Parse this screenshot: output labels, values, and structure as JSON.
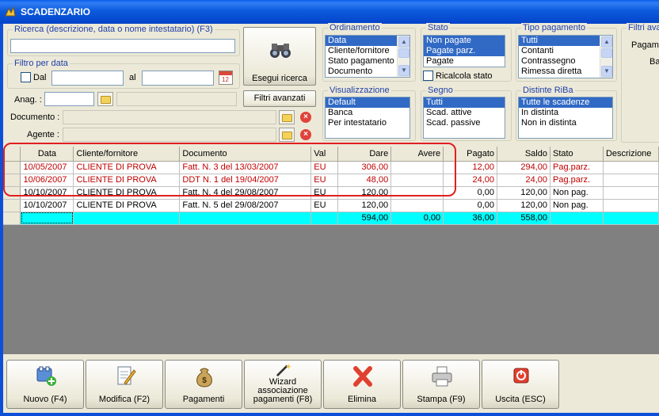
{
  "window": {
    "title": "SCADENZARIO"
  },
  "search": {
    "group_title": "Ricerca (descrizione, data o nome intestatario) (F3)",
    "value": "",
    "button_label": "Esegui ricerca"
  },
  "date_filter": {
    "group_title": "Filtro per data",
    "from_label": "Dal",
    "to_label": "al",
    "from_value": "",
    "to_value": ""
  },
  "fields": {
    "anag_label": "Anag. :",
    "documento_label": "Documento :",
    "agente_label": "Agente :",
    "advanced_button": "Filtri avanzati"
  },
  "ordinamento": {
    "title": "Ordinamento",
    "items": [
      "Data",
      "Cliente/fornitore",
      "Stato pagamento",
      "Documento"
    ],
    "selected": [
      0
    ]
  },
  "stato": {
    "title": "Stato",
    "items": [
      "Non pagate",
      "Pagate parz.",
      "Pagate"
    ],
    "selected": [
      0,
      1
    ],
    "recalc_label": "Ricalcola stato"
  },
  "tipo_pagamento": {
    "title": "Tipo pagamento",
    "items": [
      "Tutti",
      "Contanti",
      "Contrassegno",
      "Rimessa diretta"
    ],
    "selected": [
      0
    ]
  },
  "filtri_avanzati": {
    "title": "Filtri avanz",
    "line1": "Pagame",
    "line2": "Ba"
  },
  "visualizzazione": {
    "title": "Visualizzazione",
    "items": [
      "Default",
      "Banca",
      "Per intestatario"
    ],
    "selected": [
      0
    ]
  },
  "segno": {
    "title": "Segno",
    "items": [
      "Tutti",
      "Scad. attive",
      "Scad. passive"
    ],
    "selected": [
      0
    ]
  },
  "distinte": {
    "title": "Distinte RiBa",
    "items": [
      "Tutte le scadenze",
      "In distinta",
      "Non in distinta"
    ],
    "selected": [
      0
    ]
  },
  "grid": {
    "columns": [
      "Data",
      "Cliente/fornitore",
      "Documento",
      "Val",
      "Dare",
      "Avere",
      "Pagato",
      "Saldo",
      "Stato",
      "Descrizione"
    ],
    "rows": [
      {
        "data": "10/05/2007",
        "cliente": "CLIENTE DI PROVA",
        "documento": "Fatt. N. 3 del 13/03/2007",
        "val": "EU",
        "dare": "306,00",
        "avere": "",
        "pagato": "12,00",
        "saldo": "294,00",
        "stato": "Pag.parz.",
        "descrizione": "",
        "highlight": true
      },
      {
        "data": "10/06/2007",
        "cliente": "CLIENTE DI PROVA",
        "documento": "DDT N. 1 del 19/04/2007",
        "val": "EU",
        "dare": "48,00",
        "avere": "",
        "pagato": "24,00",
        "saldo": "24,00",
        "stato": "Pag.parz.",
        "descrizione": "",
        "highlight": true
      },
      {
        "data": "10/10/2007",
        "cliente": "CLIENTE DI PROVA",
        "documento": "Fatt. N. 4 del 29/08/2007",
        "val": "EU",
        "dare": "120,00",
        "avere": "",
        "pagato": "0,00",
        "saldo": "120,00",
        "stato": "Non pag.",
        "descrizione": "",
        "highlight": false
      },
      {
        "data": "10/10/2007",
        "cliente": "CLIENTE DI PROVA",
        "documento": "Fatt. N. 5 del 29/08/2007",
        "val": "EU",
        "dare": "120,00",
        "avere": "",
        "pagato": "0,00",
        "saldo": "120,00",
        "stato": "Non pag.",
        "descrizione": "",
        "highlight": false
      }
    ],
    "totals": {
      "dare": "594,00",
      "avere": "0,00",
      "pagato": "36,00",
      "saldo": "558,00"
    }
  },
  "toolbar": {
    "nuovo": "Nuovo (F4)",
    "modifica": "Modifica (F2)",
    "pagamenti": "Pagamenti",
    "wizard_1": "Wizard",
    "wizard_2": "associazione",
    "wizard_3": "pagamenti (F8)",
    "elimina": "Elimina",
    "stampa": "Stampa (F9)",
    "uscita": "Uscita (ESC)"
  },
  "colors": {
    "titlebar": "#0a5ee8",
    "selection": "#316ac5",
    "group_title": "#1f3fa8",
    "red_rows": "#c00000",
    "total_row": "#00ffff",
    "highlight_frame": "#e02020"
  }
}
